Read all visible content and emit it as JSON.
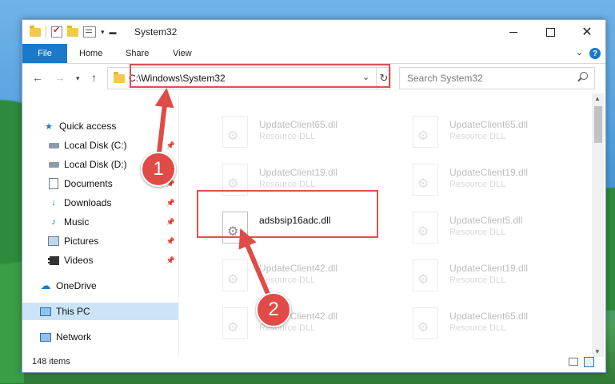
{
  "window": {
    "title": "System32"
  },
  "ribbon": {
    "file": "File",
    "home": "Home",
    "share": "Share",
    "view": "View"
  },
  "address": {
    "path": "C:\\Windows\\System32"
  },
  "search": {
    "placeholder": "Search System32"
  },
  "sidebar": {
    "items": [
      {
        "label": "Quick access",
        "icon": "star-icon",
        "pinned": false
      },
      {
        "label": "Local Disk (C:)",
        "icon": "disk-icon",
        "pinned": true
      },
      {
        "label": "Local Disk (D:)",
        "icon": "disk-icon",
        "pinned": true
      },
      {
        "label": "Documents",
        "icon": "document-icon",
        "pinned": true
      },
      {
        "label": "Downloads",
        "icon": "download-icon",
        "pinned": true
      },
      {
        "label": "Music",
        "icon": "music-icon",
        "pinned": true
      },
      {
        "label": "Pictures",
        "icon": "pictures-icon",
        "pinned": true
      },
      {
        "label": "Videos",
        "icon": "videos-icon",
        "pinned": true
      },
      {
        "label": "OneDrive",
        "icon": "cloud-icon",
        "pinned": false
      },
      {
        "label": "This PC",
        "icon": "computer-icon",
        "pinned": false,
        "selected": true
      },
      {
        "label": "Network",
        "icon": "network-icon",
        "pinned": false
      }
    ]
  },
  "files": [
    {
      "name": "UpdateClient65.dll",
      "type": "Resource DLL"
    },
    {
      "name": "UpdateClient65.dll",
      "type": "Resource DLL"
    },
    {
      "name": "UpdateClient19.dll",
      "type": "Resource DLL"
    },
    {
      "name": "UpdateClient19.dll",
      "type": "Resource DLL"
    },
    {
      "name": "adsbsip16adc.dll",
      "type": ""
    },
    {
      "name": "UpdateClient5.dll",
      "type": "Resource DLL"
    },
    {
      "name": "UpdateClient42.dll",
      "type": "Resource DLL"
    },
    {
      "name": "UpdateClient19.dll",
      "type": "Resource DLL"
    },
    {
      "name": "UpdateClient42.dll",
      "type": "Resource DLL"
    },
    {
      "name": "UpdateClient65.dll",
      "type": "Resource DLL"
    }
  ],
  "status": {
    "items": "148 items"
  },
  "callouts": {
    "one": "1",
    "two": "2"
  },
  "colors": {
    "accent": "#1979ca",
    "highlight": "#d9534f",
    "selected": "#cce4f7"
  }
}
